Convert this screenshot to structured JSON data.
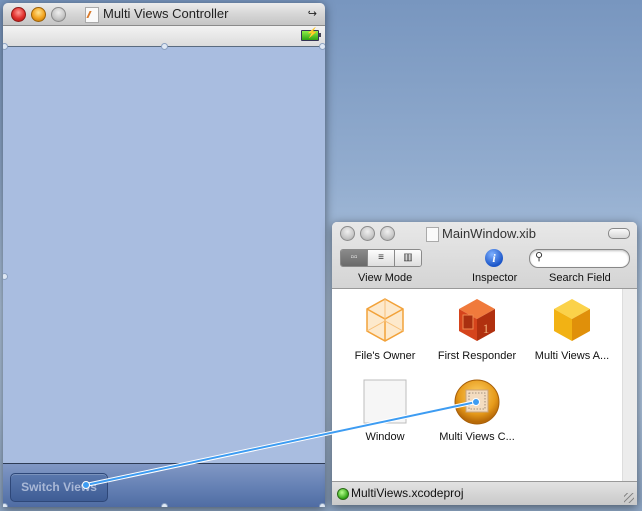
{
  "left_window": {
    "title": "Multi Views Controller",
    "battery_symbol": "⚡",
    "rotate_symbol": "↪",
    "button_label": "Switch Views"
  },
  "right_window": {
    "title": "MainWindow.xib",
    "toolbar": {
      "view_mode_label": "View Mode",
      "view_modes": [
        {
          "name": "icon",
          "glyph": "▫▫",
          "active": true
        },
        {
          "name": "list",
          "glyph": "≡",
          "active": false
        },
        {
          "name": "column",
          "glyph": "▥",
          "active": false
        }
      ],
      "inspector_label": "Inspector",
      "inspector_glyph": "i",
      "search_label": "Search Field",
      "search_value": "",
      "search_glyph": "🔍"
    },
    "items": [
      {
        "label": "File's Owner",
        "icon": "wireframe-cube-icon",
        "color": "#f2a23a"
      },
      {
        "label": "First Responder",
        "icon": "red-cube-icon",
        "color": "#d5441c"
      },
      {
        "label": "Multi Views A...",
        "icon": "yellow-cube-icon",
        "color": "#f2b214"
      },
      {
        "label": "Window",
        "icon": "window-icon",
        "color": "#f4f4f4"
      },
      {
        "label": "Multi Views C...",
        "icon": "view-controller-icon",
        "color": "#e69a1a"
      }
    ],
    "footer": {
      "project": "MultiViews.xcodeproj",
      "status_color": "#36b21a"
    }
  },
  "connection": {
    "from": "Switch Views",
    "to": "Multi Views C...",
    "color": "#3d9cf2"
  }
}
